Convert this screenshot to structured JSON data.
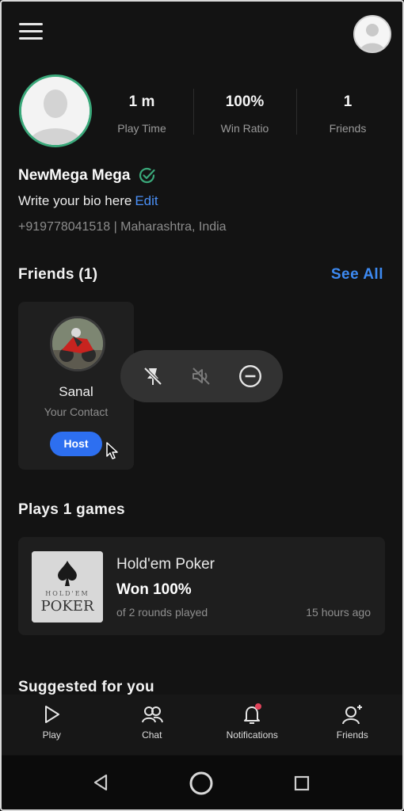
{
  "header": {
    "menu_icon": "hamburger-menu-icon",
    "avatar_icon": "user-avatar-icon"
  },
  "profile": {
    "stats": [
      {
        "value": "1 m",
        "label": "Play Time"
      },
      {
        "value": "100%",
        "label": "Win Ratio"
      },
      {
        "value": "1",
        "label": "Friends"
      }
    ],
    "name": "NewMega Mega",
    "verified_icon": "verified-check-icon",
    "bio": "Write your bio here",
    "bio_edit": "Edit",
    "contact": "+919778041518 | Maharashtra, India",
    "accent_color": "#3aa87a"
  },
  "friends_section": {
    "title": "Friends (1)",
    "see_all": "See All",
    "friends": [
      {
        "name": "Sanal",
        "subtitle": "Your Contact",
        "button": "Host"
      }
    ]
  },
  "popup_actions": [
    {
      "icon": "unpin-icon"
    },
    {
      "icon": "mute-icon"
    },
    {
      "icon": "remove-icon"
    }
  ],
  "games_section": {
    "title": "Plays 1 games",
    "games": [
      {
        "thumb_text_top": "HOLD'EM",
        "thumb_text_bottom": "POKER",
        "title": "Hold'em Poker",
        "result": "Won 100%",
        "rounds": "of 2 rounds played",
        "time": "15 hours ago"
      }
    ]
  },
  "suggested_title": "Suggested for you",
  "bottom_nav": [
    {
      "label": "Play",
      "icon": "play-icon"
    },
    {
      "label": "Chat",
      "icon": "chat-icon"
    },
    {
      "label": "Notifications",
      "icon": "bell-icon"
    },
    {
      "label": "Friends",
      "icon": "add-friend-icon"
    }
  ],
  "system_nav": {
    "back": "back-icon",
    "home": "home-icon",
    "recents": "recents-icon"
  }
}
